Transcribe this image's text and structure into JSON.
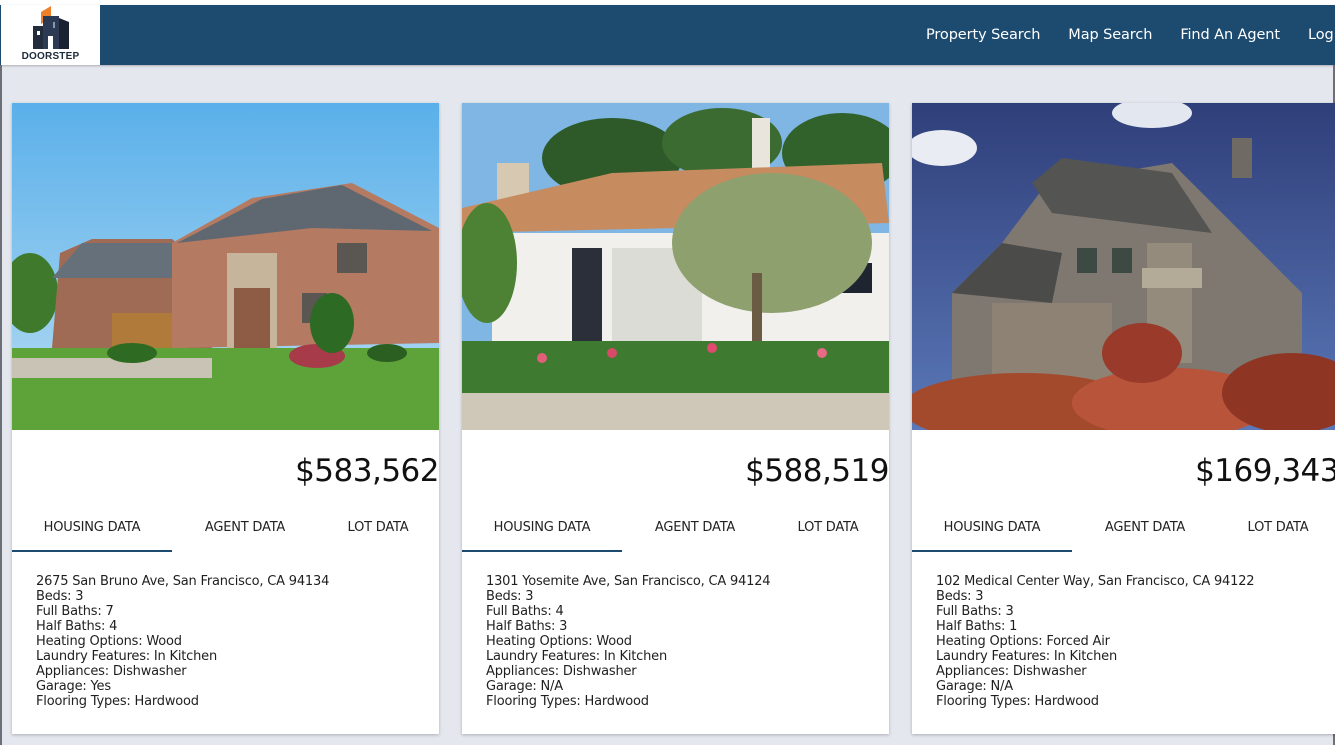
{
  "brand": {
    "name": "DOORSTEP"
  },
  "nav": {
    "items": [
      {
        "label": "Property Search"
      },
      {
        "label": "Map Search"
      },
      {
        "label": "Find An Agent"
      },
      {
        "label": "Log In"
      }
    ]
  },
  "colors": {
    "header": "#1d4a6f",
    "background": "#e5e7ef",
    "tab_indicator": "#1d4a6f"
  },
  "listings": [
    {
      "price": "$583,562",
      "tabs": [
        "HOUSING DATA",
        "AGENT DATA",
        "LOT DATA"
      ],
      "active_tab": "HOUSING DATA",
      "address": "2675 San Bruno Ave, San Francisco, CA 94134",
      "beds": "Beds: 3",
      "full_baths": "Full Baths: 7",
      "half_baths": "Half Baths: 4",
      "heating": "Heating Options: Wood",
      "laundry": "Laundry Features: In Kitchen",
      "appliances": "Appliances: Dishwasher",
      "garage": "Garage: Yes",
      "flooring": "Flooring Types: Hardwood"
    },
    {
      "price": "$588,519",
      "tabs": [
        "HOUSING DATA",
        "AGENT DATA",
        "LOT DATA"
      ],
      "active_tab": "HOUSING DATA",
      "address": "1301 Yosemite Ave, San Francisco, CA 94124",
      "beds": "Beds: 3",
      "full_baths": "Full Baths: 4",
      "half_baths": "Half Baths: 3",
      "heating": "Heating Options: Wood",
      "laundry": "Laundry Features: In Kitchen",
      "appliances": "Appliances: Dishwasher",
      "garage": "Garage: N/A",
      "flooring": "Flooring Types: Hardwood"
    },
    {
      "price": "$169,343",
      "tabs": [
        "HOUSING DATA",
        "AGENT DATA",
        "LOT DATA"
      ],
      "active_tab": "HOUSING DATA",
      "address": "102 Medical Center Way, San Francisco, CA 94122",
      "beds": "Beds: 3",
      "full_baths": "Full Baths: 3",
      "half_baths": "Half Baths: 1",
      "heating": "Heating Options: Forced Air",
      "laundry": "Laundry Features: In Kitchen",
      "appliances": "Appliances: Dishwasher",
      "garage": "Garage: N/A",
      "flooring": "Flooring Types: Hardwood"
    }
  ]
}
